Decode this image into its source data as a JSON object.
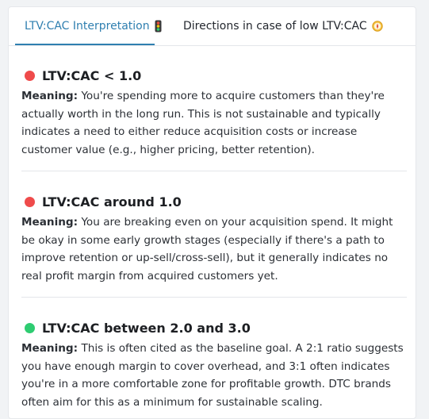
{
  "tabs": [
    {
      "label": "LTV:CAC Interpretation",
      "icon": "traffic-light-icon",
      "active": true
    },
    {
      "label": "Directions in case of low LTV:CAC",
      "icon": "compass-icon",
      "active": false
    }
  ],
  "colors": {
    "accent": "#2f7fb0",
    "red": "#ef4b4b",
    "green": "#2ecc71"
  },
  "sections": [
    {
      "status": "red",
      "title": "LTV:CAC < 1.0",
      "meaning_label": "Meaning:",
      "text": "You're spending more to acquire customers than they're actually worth in the long run. This is not sustainable and typically indicates a need to either reduce acquisition costs or increase customer value (e.g., higher pricing, better retention)."
    },
    {
      "status": "red",
      "title": "LTV:CAC around 1.0",
      "meaning_label": "Meaning:",
      "text": "You are breaking even on your acquisition spend. It might be okay in some early growth stages (especially if there's a path to improve retention or up-sell/cross-sell), but it generally indicates no real profit margin from acquired customers yet."
    },
    {
      "status": "green",
      "title": "LTV:CAC between 2.0 and 3.0",
      "meaning_label": "Meaning:",
      "text": "This is often cited as the baseline goal. A 2:1 ratio suggests you have enough margin to cover overhead, and 3:1 often indicates you're in a more comfortable zone for profitable growth. DTC brands often aim for this as a minimum for sustainable scaling."
    }
  ]
}
